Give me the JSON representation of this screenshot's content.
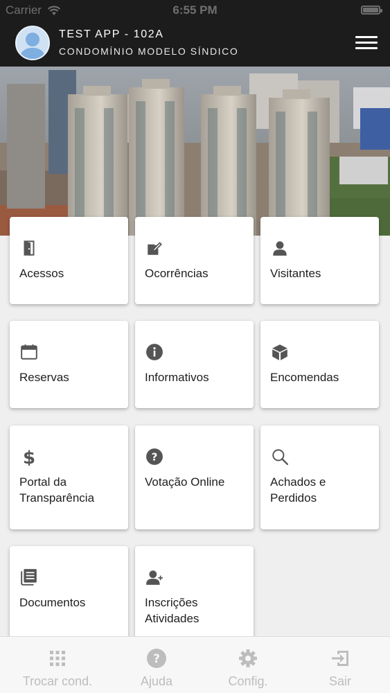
{
  "status_bar": {
    "carrier": "Carrier",
    "time": "6:55 PM"
  },
  "header": {
    "title": "TEST APP - 102A",
    "subtitle": "CONDOMÍNIO MODELO SÍNDICO"
  },
  "colors": {
    "header_bg": "#1c1c1c",
    "icon": "#555555",
    "tab_inactive": "#bdbdbd"
  },
  "menu": {
    "items": [
      {
        "label": "Acessos",
        "icon": "door-icon"
      },
      {
        "label": "Ocorrências",
        "icon": "edit-icon"
      },
      {
        "label": "Visitantes",
        "icon": "person-icon"
      },
      {
        "label": "Reservas",
        "icon": "calendar-icon"
      },
      {
        "label": "Informativos",
        "icon": "info-icon"
      },
      {
        "label": "Encomendas",
        "icon": "package-icon"
      },
      {
        "label": "Portal da Transparência",
        "icon": "dollar-icon"
      },
      {
        "label": "Votação Online",
        "icon": "question-icon"
      },
      {
        "label": "Achados e Perdidos",
        "icon": "search-icon"
      },
      {
        "label": "Documentos",
        "icon": "document-icon"
      },
      {
        "label": "Inscrições Atividades",
        "icon": "person-add-icon"
      }
    ]
  },
  "tabbar": {
    "tabs": [
      {
        "label": "Trocar cond.",
        "icon": "grid-icon"
      },
      {
        "label": "Ajuda",
        "icon": "help-icon"
      },
      {
        "label": "Config.",
        "icon": "gear-icon"
      },
      {
        "label": "Sair",
        "icon": "exit-icon"
      }
    ]
  }
}
